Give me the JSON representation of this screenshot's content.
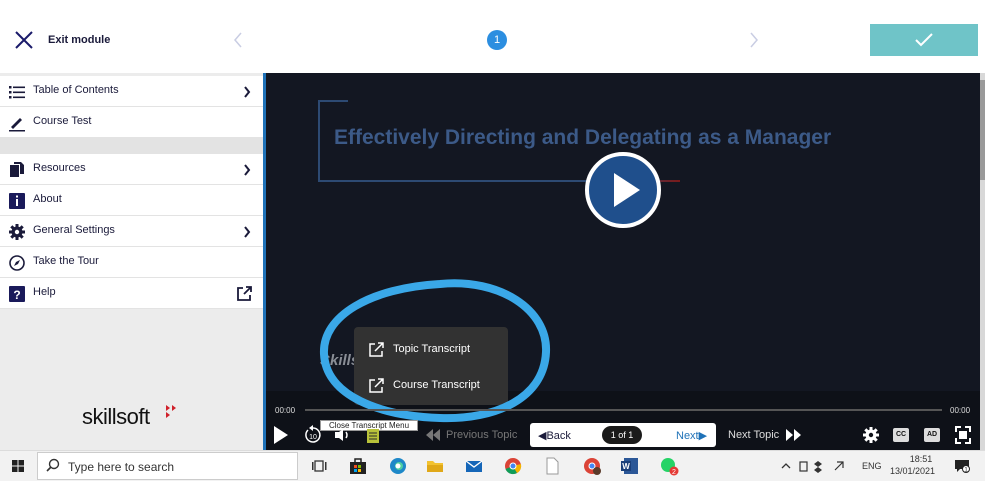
{
  "header": {
    "exit_label": "Exit module",
    "page_badge": "1",
    "complete_button_color": "#6fc4c8"
  },
  "sidebar": {
    "items": [
      {
        "label": "Table of Contents",
        "icon": "list-icon",
        "has_arrow": true
      },
      {
        "label": "Course Test",
        "icon": "pencil-icon",
        "has_arrow": false
      },
      {
        "label": "Resources",
        "icon": "documents-icon",
        "has_arrow": true
      },
      {
        "label": "About",
        "icon": "info-icon",
        "has_arrow": false
      },
      {
        "label": "General Settings",
        "icon": "gear-icon",
        "has_arrow": true
      },
      {
        "label": "Take the Tour",
        "icon": "compass-icon",
        "has_arrow": false
      },
      {
        "label": "Help",
        "icon": "help-icon",
        "has_arrow": false,
        "external": true
      }
    ],
    "logo_text": "skillsoft"
  },
  "player": {
    "title": "Effectively Directing and Delegating as a Manager",
    "watermark": "Skills",
    "time_start": "00:00",
    "time_end": "00:00",
    "tooltip": "Close Transcript Menu",
    "transcript_menu": [
      "Topic Transcript",
      "Course Transcript"
    ],
    "prev_topic": "Previous Topic",
    "back": "Back",
    "page_count": "1 of 1",
    "next": "Next",
    "next_topic": "Next Topic",
    "cc": "CC",
    "ad": "AD",
    "accent_color": "#1f72b8"
  },
  "taskbar": {
    "search_placeholder": "Type here to search",
    "lang": "ENG",
    "time": "18:51",
    "date": "13/01/2021",
    "notification_count": "1"
  }
}
